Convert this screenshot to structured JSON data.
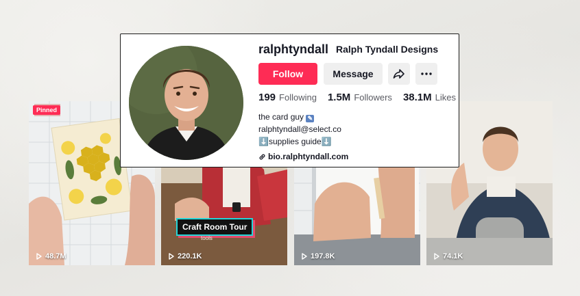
{
  "profile": {
    "username": "ralphtyndall",
    "nickname": "Ralph Tyndall Designs",
    "follow_label": "Follow",
    "message_label": "Message",
    "stats": {
      "following_count": "199",
      "following_label": "Following",
      "followers_count": "1.5M",
      "followers_label": "Followers",
      "likes_count": "38.1M",
      "likes_label": "Likes"
    },
    "bio": {
      "line1": "the card guy",
      "line2": "ralphtyndall@select.co",
      "line3": "supplies guide",
      "arrow_glyph": "⬇️"
    },
    "link": "bio.ralphtyndall.com"
  },
  "videos": [
    {
      "views": "48.7M",
      "pinned_label": "Pinned"
    },
    {
      "views": "220.1K",
      "overlay_title": "Craft Room Tour",
      "overlay_sub": "tools"
    },
    {
      "views": "197.8K"
    },
    {
      "views": "74.1K"
    }
  ],
  "colors": {
    "accent": "#fe2c55",
    "text": "#161823",
    "muted": "#5a5b62",
    "button_bg": "#efefef"
  },
  "icons": [
    "share-icon",
    "more-icon",
    "link-icon",
    "play-icon"
  ]
}
